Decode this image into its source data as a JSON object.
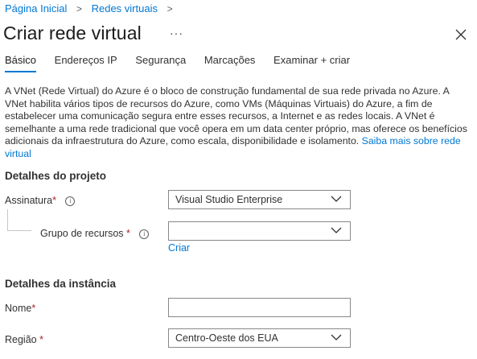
{
  "breadcrumb": {
    "home": "Página Inicial",
    "parent": "Redes virtuais"
  },
  "title": "Criar rede virtual",
  "more_label": "···",
  "tabs": [
    {
      "label": "Básico",
      "active": true
    },
    {
      "label": "Endereços IP"
    },
    {
      "label": "Segurança"
    },
    {
      "label": "Marcações"
    },
    {
      "label": "Examinar + criar"
    }
  ],
  "description": {
    "text": "A VNet (Rede Virtual) do Azure é o bloco de construção fundamental de sua rede privada no Azure. A VNet habilita vários tipos de recursos do Azure, como VMs (Máquinas Virtuais) do Azure, a fim de estabelecer uma comunicação segura entre esses recursos, a Internet e as redes locais. A VNet é semelhante a uma rede tradicional que você opera em um data center próprio, mas oferece os benefícios adicionais da infraestrutura do Azure, como escala, disponibilidade e isolamento.",
    "link": "Saiba mais sobre rede virtual"
  },
  "project_details": {
    "heading": "Detalhes do projeto",
    "subscription": {
      "label": "Assinatura",
      "value": "Visual Studio Enterprise"
    },
    "resource_group": {
      "label": "Grupo de recursos",
      "value": "",
      "create_link": "Criar"
    }
  },
  "instance_details": {
    "heading": "Detalhes da instância",
    "name": {
      "label": "Nome",
      "value": ""
    },
    "region": {
      "label": "Região",
      "value": "Centro-Oeste dos EUA"
    }
  },
  "required_marker": "*",
  "info_glyph": "i",
  "colors": {
    "accent": "#0078d4",
    "required": "#a4262c",
    "text": "#323130",
    "border": "#8a8886"
  },
  "icons": {
    "close": "close-icon",
    "chevron": "chevron-down-icon",
    "info": "info-icon",
    "breadcrumb_sep": "chevron-right-icon"
  }
}
